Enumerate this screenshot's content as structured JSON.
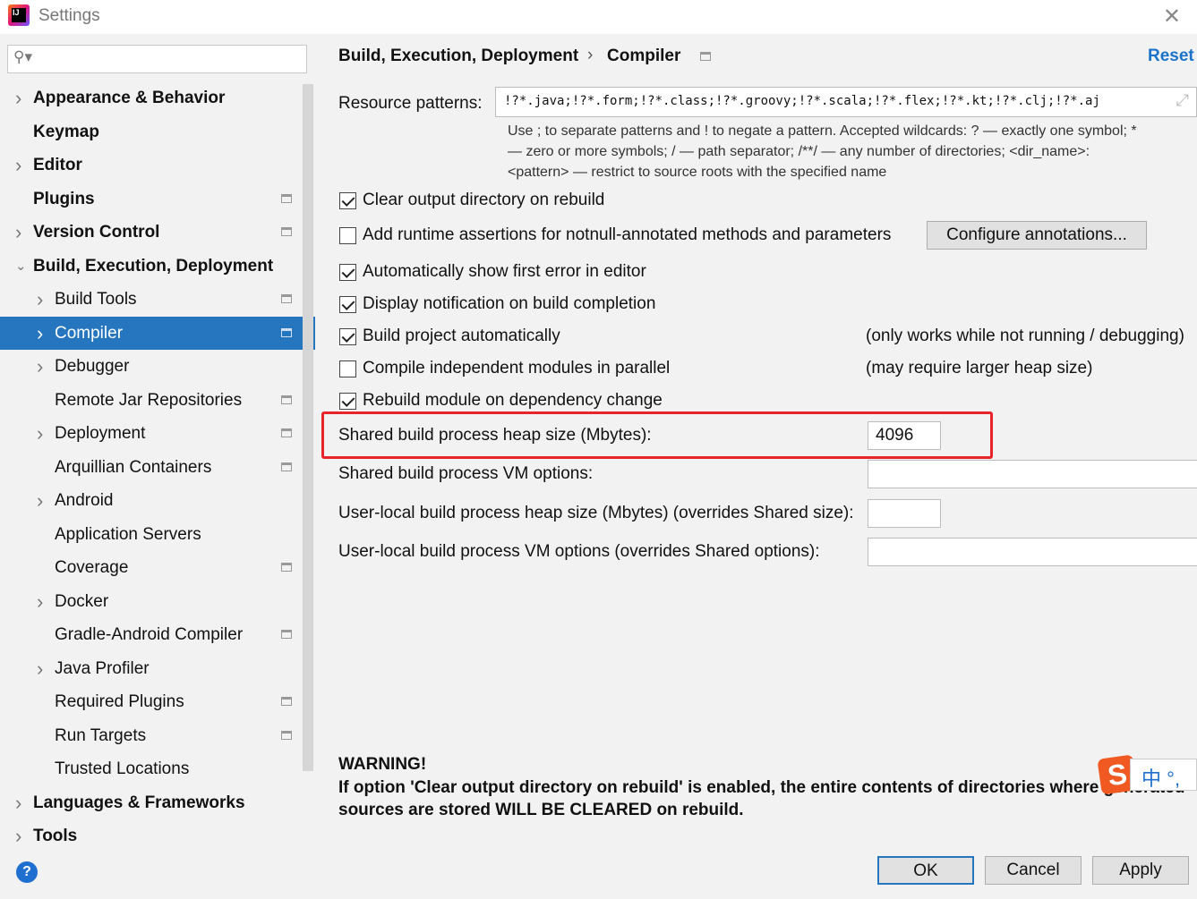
{
  "window": {
    "title": "Settings",
    "icon_text": "IJ"
  },
  "search": {
    "placeholder": "",
    "icon": "search-icon"
  },
  "sidebar": {
    "items": [
      {
        "label": "Appearance & Behavior",
        "level": 0,
        "expandable": true,
        "expanded": false,
        "project": false,
        "selected": false
      },
      {
        "label": "Keymap",
        "level": 0,
        "expandable": false,
        "project": false
      },
      {
        "label": "Editor",
        "level": 0,
        "expandable": true,
        "project": false
      },
      {
        "label": "Plugins",
        "level": 0,
        "expandable": false,
        "project": true
      },
      {
        "label": "Version Control",
        "level": 0,
        "expandable": true,
        "project": true
      },
      {
        "label": "Build, Execution, Deployment",
        "level": 0,
        "expandable": true,
        "expanded": true,
        "project": false
      },
      {
        "label": "Build Tools",
        "level": 1,
        "expandable": true,
        "project": true
      },
      {
        "label": "Compiler",
        "level": 1,
        "expandable": true,
        "project": true,
        "selected": true
      },
      {
        "label": "Debugger",
        "level": 1,
        "expandable": true,
        "project": false
      },
      {
        "label": "Remote Jar Repositories",
        "level": 1,
        "expandable": false,
        "project": true
      },
      {
        "label": "Deployment",
        "level": 1,
        "expandable": true,
        "project": true
      },
      {
        "label": "Arquillian Containers",
        "level": 1,
        "expandable": false,
        "project": true
      },
      {
        "label": "Android",
        "level": 1,
        "expandable": true,
        "project": false
      },
      {
        "label": "Application Servers",
        "level": 1,
        "expandable": false,
        "project": false
      },
      {
        "label": "Coverage",
        "level": 1,
        "expandable": false,
        "project": true
      },
      {
        "label": "Docker",
        "level": 1,
        "expandable": true,
        "project": false
      },
      {
        "label": "Gradle-Android Compiler",
        "level": 1,
        "expandable": false,
        "project": true
      },
      {
        "label": "Java Profiler",
        "level": 1,
        "expandable": true,
        "project": false
      },
      {
        "label": "Required Plugins",
        "level": 1,
        "expandable": false,
        "project": true
      },
      {
        "label": "Run Targets",
        "level": 1,
        "expandable": false,
        "project": true
      },
      {
        "label": "Trusted Locations",
        "level": 1,
        "expandable": false,
        "project": false
      },
      {
        "label": "Languages & Frameworks",
        "level": 0,
        "expandable": true,
        "project": false
      },
      {
        "label": "Tools",
        "level": 0,
        "expandable": true,
        "project": false
      }
    ]
  },
  "breadcrumb": {
    "parent": "Build, Execution, Deployment",
    "separator": "›",
    "current": "Compiler",
    "reset": "Reset"
  },
  "resource": {
    "label": "Resource patterns:",
    "value": "!?*.java;!?*.form;!?*.class;!?*.groovy;!?*.scala;!?*.flex;!?*.kt;!?*.clj;!?*.aj",
    "hint1": "Use ; to separate patterns and ! to negate a pattern. Accepted wildcards: ? — exactly one symbol; *",
    "hint2": "— zero or more symbols; / — path separator; /**/ — any number of directories; <dir_name>:",
    "hint3": "<pattern> — restrict to source roots with the specified name"
  },
  "options": [
    {
      "label": "Clear output directory on rebuild",
      "checked": true
    },
    {
      "label": "Add runtime assertions for notnull-annotated methods and parameters",
      "checked": false
    },
    {
      "label": "Automatically show first error in editor",
      "checked": true
    },
    {
      "label": "Display notification on build completion",
      "checked": true
    },
    {
      "label": "Build project automatically",
      "checked": true,
      "note": "(only works while not running / debugging)"
    },
    {
      "label": "Compile independent modules in parallel",
      "checked": false,
      "note": "(may require larger heap size)"
    },
    {
      "label": "Rebuild module on dependency change",
      "checked": true
    }
  ],
  "configure_button": "Configure annotations...",
  "fields": [
    {
      "label": "Shared build process heap size (Mbytes):",
      "value": "4096",
      "highlighted": true
    },
    {
      "label": "Shared build process VM options:",
      "value": ""
    },
    {
      "label": "User-local build process heap size (Mbytes) (overrides Shared size):",
      "value": ""
    },
    {
      "label": "User-local build process VM options (overrides Shared options):",
      "value": ""
    }
  ],
  "warning": {
    "title": "WARNING!",
    "line1": "If option 'Clear output directory on rebuild' is enabled, the entire contents of directories where generated",
    "line2": "sources are stored WILL BE CLEARED on rebuild."
  },
  "ime": {
    "mode": "中",
    "punct": "°,"
  },
  "footer": {
    "ok": "OK",
    "cancel": "Cancel",
    "apply": "Apply",
    "help": "?"
  },
  "colors": {
    "accent": "#2675bf",
    "highlight": "#e8242a",
    "link": "#1a73c9"
  }
}
